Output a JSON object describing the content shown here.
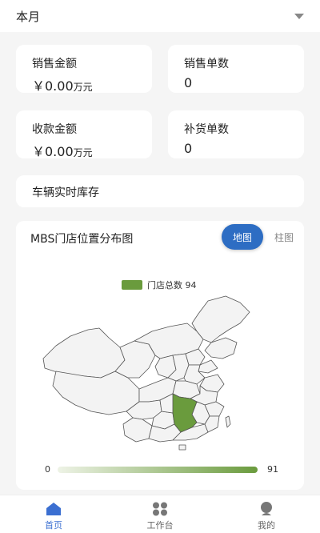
{
  "header": {
    "period": "本月"
  },
  "stats": [
    {
      "label": "销售金额",
      "value": "￥0.00",
      "unit": "万元"
    },
    {
      "label": "销售单数",
      "value": "0",
      "unit": ""
    },
    {
      "label": "收款金额",
      "value": "￥0.00",
      "unit": "万元"
    },
    {
      "label": "补货单数",
      "value": "0",
      "unit": ""
    }
  ],
  "inventory": {
    "label": "车辆实时库存"
  },
  "map_card": {
    "title": "MBS门店位置分布图",
    "btn_map": "地图",
    "btn_bar": "柱图",
    "legend": "门店总数 94",
    "range_min": "0",
    "range_max": "91"
  },
  "colors": {
    "accent": "#2d6dc3",
    "highlight": "#6a9b3d",
    "tab_active": "#3b6fd1"
  },
  "tabs": [
    {
      "label": "首页",
      "icon": "home-icon",
      "active": true
    },
    {
      "label": "工作台",
      "icon": "grid-icon",
      "active": false
    },
    {
      "label": "我的",
      "icon": "user-icon",
      "active": false
    }
  ]
}
